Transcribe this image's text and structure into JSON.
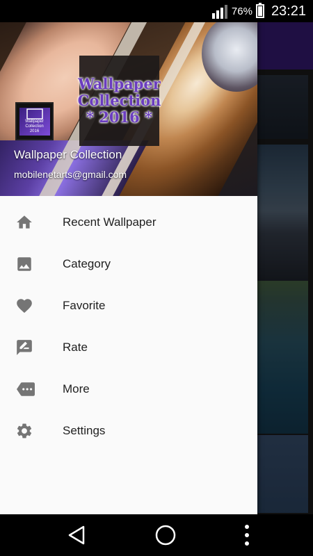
{
  "status_bar": {
    "battery_percent": "76%",
    "time": "23:21",
    "battery_level": 0.76,
    "signal_bars": 3
  },
  "drawer": {
    "header": {
      "logo_lines": [
        "Wallpaper",
        "Collection",
        "* 2016 *"
      ],
      "app_icon_text": [
        "Wallpaper",
        "Collection",
        "2016"
      ],
      "app_title": "Wallpaper Collection",
      "email": "mobilenetarts@gmail.com"
    },
    "menu": [
      {
        "label": "Recent Wallpaper",
        "icon": "home-icon"
      },
      {
        "label": "Category",
        "icon": "image-icon"
      },
      {
        "label": "Favorite",
        "icon": "heart-icon"
      },
      {
        "label": "Rate",
        "icon": "rate-review-icon"
      },
      {
        "label": "More",
        "icon": "more-tag-icon"
      },
      {
        "label": "Settings",
        "icon": "gear-icon"
      }
    ]
  },
  "colors": {
    "toolbar": "#3a1d7a",
    "icon_gray": "#757575",
    "logo_purple": "#6b3dbf"
  },
  "nav_bar": {
    "icons": [
      "back-icon",
      "home-circle-icon",
      "overflow-menu-icon"
    ]
  }
}
